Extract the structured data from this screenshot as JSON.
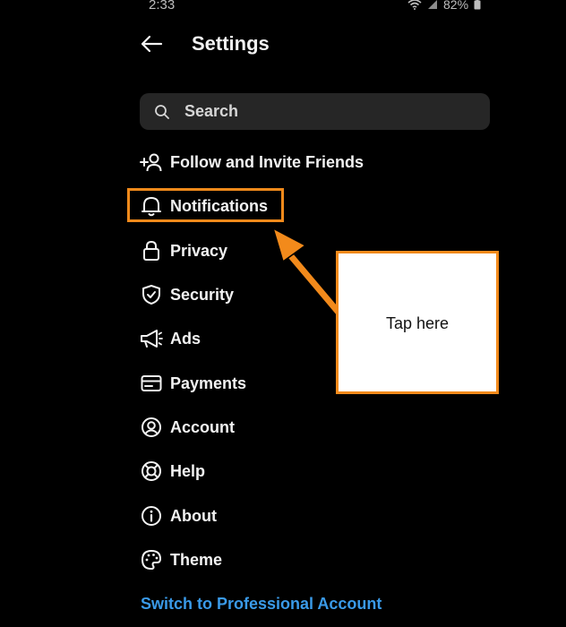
{
  "status_bar": {
    "time": "2:33",
    "battery": "82%"
  },
  "header": {
    "title": "Settings",
    "back_icon": "arrow-left-icon"
  },
  "search": {
    "placeholder": "Search",
    "icon": "search-icon"
  },
  "menu": {
    "items": [
      {
        "label": "Follow and Invite Friends",
        "icon": "add-person-icon"
      },
      {
        "label": "Notifications",
        "icon": "bell-icon"
      },
      {
        "label": "Privacy",
        "icon": "lock-icon"
      },
      {
        "label": "Security",
        "icon": "shield-icon"
      },
      {
        "label": "Ads",
        "icon": "megaphone-icon"
      },
      {
        "label": "Payments",
        "icon": "card-icon"
      },
      {
        "label": "Account",
        "icon": "account-icon"
      },
      {
        "label": "Help",
        "icon": "lifebuoy-icon"
      },
      {
        "label": "About",
        "icon": "info-icon"
      },
      {
        "label": "Theme",
        "icon": "palette-icon"
      }
    ]
  },
  "switch_link": "Switch to Professional Account",
  "annotation": {
    "callout_text": "Tap here",
    "highlight_color": "#f28a1b"
  },
  "colors": {
    "background": "#000000",
    "text": "#f2f2f2",
    "link": "#3a9ae8",
    "search_bg": "#262626",
    "annotation": "#f28a1b"
  }
}
